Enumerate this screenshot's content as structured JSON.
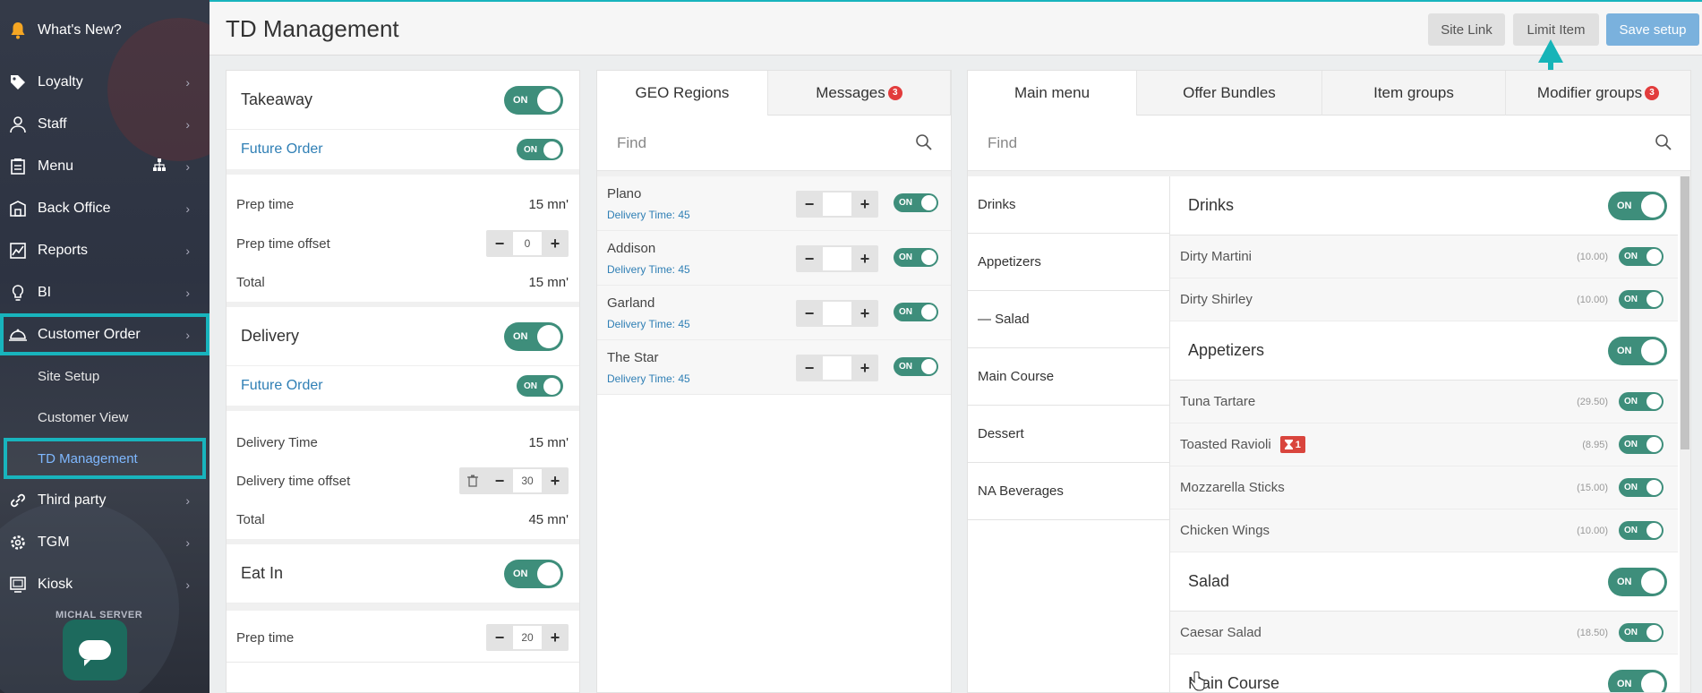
{
  "sidebar": {
    "items": [
      {
        "label": "What's New?",
        "icon": "bell-icon"
      },
      {
        "label": "Loyalty",
        "icon": "tag-icon"
      },
      {
        "label": "Staff",
        "icon": "user-icon"
      },
      {
        "label": "Menu",
        "icon": "menu-book-icon"
      },
      {
        "label": "Back Office",
        "icon": "office-icon"
      },
      {
        "label": "Reports",
        "icon": "chart-icon"
      },
      {
        "label": "BI",
        "icon": "lightbulb-icon"
      },
      {
        "label": "Customer Order",
        "icon": "cloche-icon"
      },
      {
        "label": "Third party",
        "icon": "link-icon"
      },
      {
        "label": "TGM",
        "icon": "gear-icon"
      },
      {
        "label": "Kiosk",
        "icon": "kiosk-icon"
      }
    ],
    "sub_items": [
      "Site Setup",
      "Customer View",
      "TD Management"
    ],
    "user": "MICHAL SERVER"
  },
  "header": {
    "title": "TD Management",
    "buttons": {
      "site_link": "Site Link",
      "limit_item": "Limit Item",
      "save_setup": "Save setup"
    }
  },
  "left": {
    "takeaway": {
      "title": "Takeaway",
      "toggle": "ON",
      "future_order": "Future Order",
      "future_toggle": "ON",
      "prep_time_label": "Prep time",
      "prep_time_value": "15  mn'",
      "prep_offset_label": "Prep time offset",
      "prep_offset_value": "0",
      "total_label": "Total",
      "total_value": "15  mn'"
    },
    "delivery": {
      "title": "Delivery",
      "toggle": "ON",
      "future_order": "Future Order",
      "future_toggle": "ON",
      "time_label": "Delivery Time",
      "time_value": "15  mn'",
      "offset_label": "Delivery time offset",
      "offset_value": "30",
      "total_label": "Total",
      "total_value": "45  mn'"
    },
    "eatin": {
      "title": "Eat In",
      "toggle": "ON",
      "prep_time_label": "Prep time",
      "prep_time_value": "20"
    }
  },
  "middle": {
    "tabs": [
      {
        "label": "GEO Regions"
      },
      {
        "label": "Messages",
        "badge": "3"
      }
    ],
    "find_placeholder": "Find",
    "regions": [
      {
        "name": "Plano",
        "sub": "Delivery Time: 45",
        "toggle": "ON"
      },
      {
        "name": "Addison",
        "sub": "Delivery Time: 45",
        "toggle": "ON"
      },
      {
        "name": "Garland",
        "sub": "Delivery Time: 45",
        "toggle": "ON"
      },
      {
        "name": "The Star",
        "sub": "Delivery Time: 45",
        "toggle": "ON"
      }
    ]
  },
  "right": {
    "tabs": [
      {
        "label": "Main menu"
      },
      {
        "label": "Offer Bundles"
      },
      {
        "label": "Item groups"
      },
      {
        "label": "Modifier groups",
        "badge": "3"
      }
    ],
    "find_placeholder": "Find",
    "categories": [
      "Drinks",
      "Appetizers",
      "— Salad",
      "Main Course",
      "Dessert",
      "NA Beverages"
    ],
    "groups": {
      "drinks": {
        "title": "Drinks",
        "toggle": "ON"
      },
      "appetizers": {
        "title": "Appetizers",
        "toggle": "ON"
      },
      "salad": {
        "title": "Salad",
        "toggle": "ON"
      },
      "main_course": {
        "title": "Main Course",
        "toggle": "ON"
      }
    },
    "items": {
      "dirty_martini": {
        "name": "Dirty Martini",
        "price": "(10.00)",
        "toggle": "ON"
      },
      "dirty_shirley": {
        "name": "Dirty Shirley",
        "price": "(10.00)",
        "toggle": "ON"
      },
      "tuna_tartare": {
        "name": "Tuna Tartare",
        "price": "(29.50)",
        "toggle": "ON"
      },
      "toasted_ravioli": {
        "name": "Toasted Ravioli",
        "badge": "1",
        "price": "(8.95)",
        "toggle": "ON"
      },
      "mozzarella_sticks": {
        "name": "Mozzarella Sticks",
        "price": "(15.00)",
        "toggle": "ON"
      },
      "chicken_wings": {
        "name": "Chicken Wings",
        "price": "(10.00)",
        "toggle": "ON"
      },
      "caesar_salad": {
        "name": "Caesar Salad",
        "price": "(18.50)",
        "toggle": "ON"
      }
    }
  },
  "colors": {
    "accent": "#18b4bd",
    "toggle": "#3e8e7b",
    "link": "#2f7fb5",
    "save": "#7ab1dd",
    "badge": "#e23c3c"
  }
}
